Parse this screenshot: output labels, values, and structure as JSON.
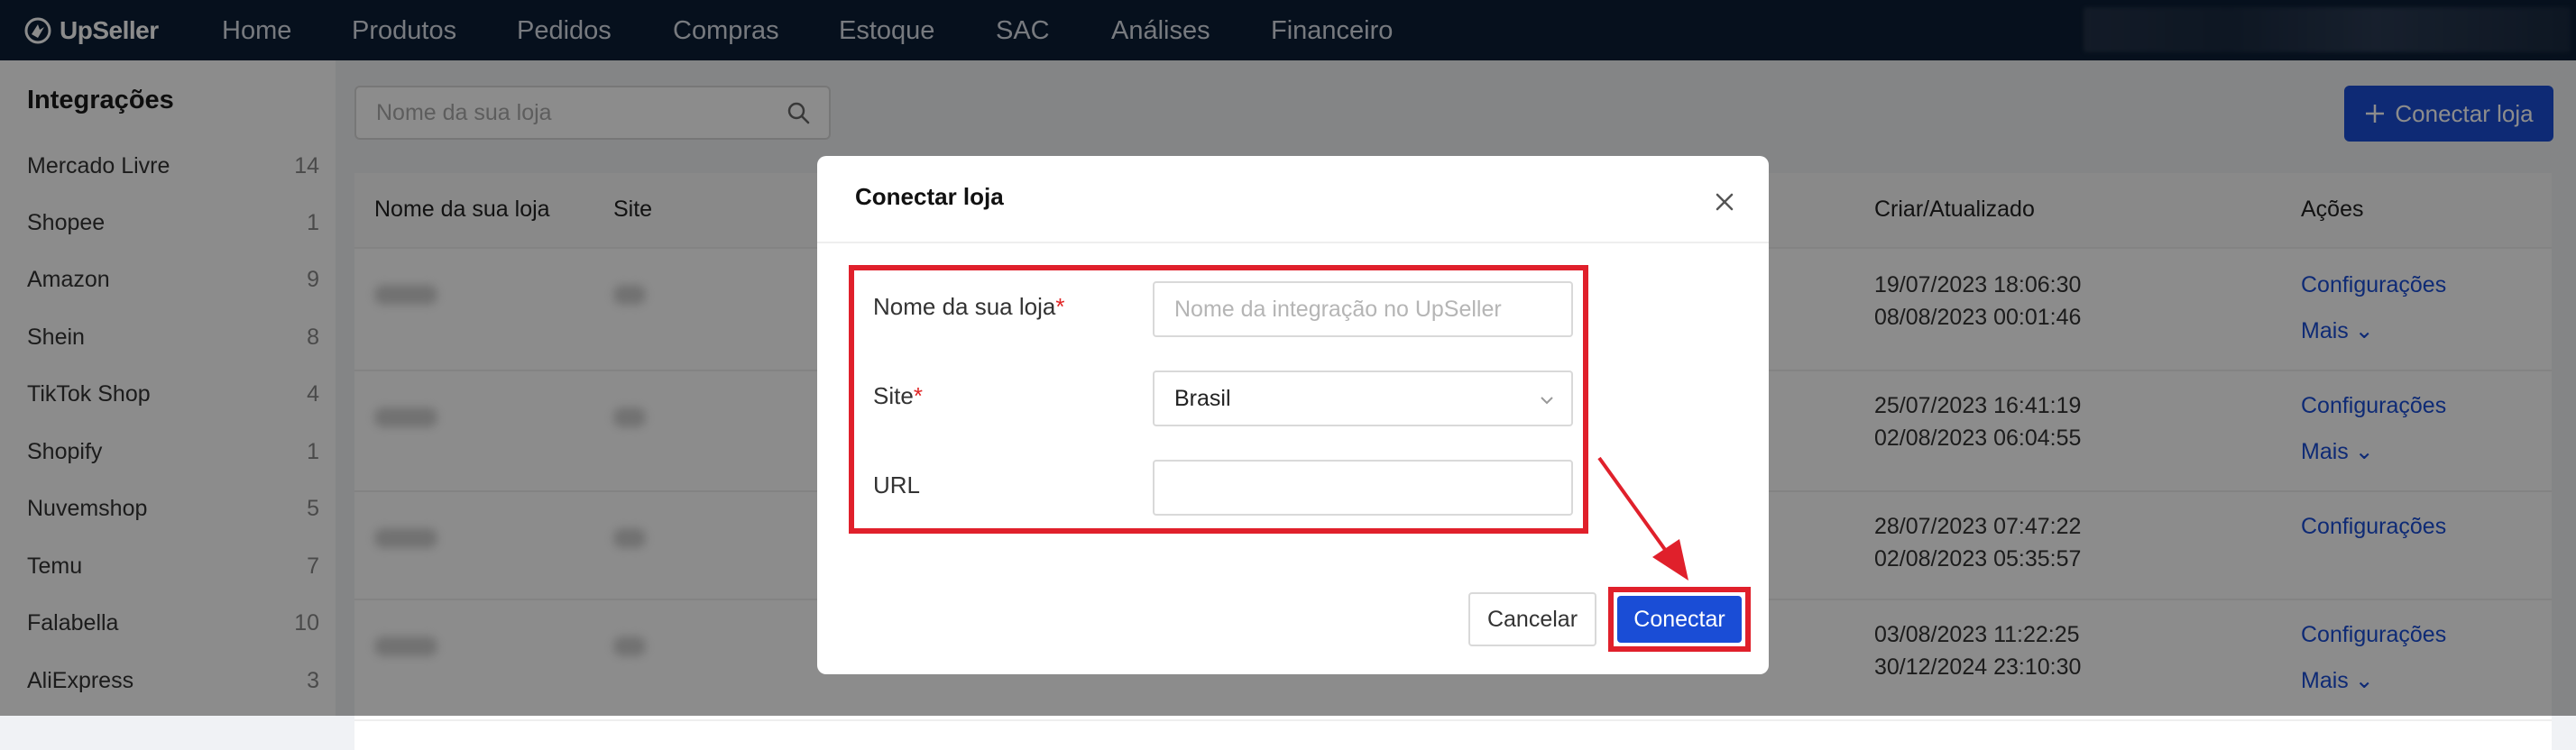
{
  "app": {
    "logo_text": "UpSeller"
  },
  "nav": {
    "items": [
      "Home",
      "Produtos",
      "Pedidos",
      "Compras",
      "Estoque",
      "SAC",
      "Análises",
      "Financeiro"
    ]
  },
  "sidebar": {
    "title": "Integrações",
    "items": [
      {
        "label": "Mercado Livre",
        "count": "14"
      },
      {
        "label": "Shopee",
        "count": "1"
      },
      {
        "label": "Amazon",
        "count": "9"
      },
      {
        "label": "Shein",
        "count": "8"
      },
      {
        "label": "TikTok Shop",
        "count": "4"
      },
      {
        "label": "Shopify",
        "count": "1"
      },
      {
        "label": "Nuvemshop",
        "count": "5"
      },
      {
        "label": "Temu",
        "count": "7"
      },
      {
        "label": "Falabella",
        "count": "10"
      },
      {
        "label": "AliExpress",
        "count": "3"
      }
    ]
  },
  "toolbar": {
    "search_placeholder": "Nome da sua loja",
    "connect_label": "Conectar loja"
  },
  "table": {
    "headers": {
      "name": "Nome da sua loja",
      "site": "Site",
      "created": "Criar/Atualizado",
      "actions": "Ações"
    },
    "rows": [
      {
        "created": "19/07/2023 18:06:30",
        "updated": "08/08/2023 00:01:46",
        "config": "Configurações",
        "more": "Mais"
      },
      {
        "created": "25/07/2023 16:41:19",
        "updated": "02/08/2023 06:04:55",
        "config": "Configurações",
        "more": "Mais"
      },
      {
        "created": "28/07/2023 07:47:22",
        "updated": "02/08/2023 05:35:57",
        "config": "Configurações",
        "more": ""
      },
      {
        "created": "03/08/2023 11:22:25",
        "updated": "30/12/2024 23:10:30",
        "config": "Configurações",
        "more": "Mais"
      }
    ]
  },
  "modal": {
    "title": "Conectar loja",
    "fields": {
      "name_label": "Nome da sua loja",
      "name_placeholder": "Nome da integração no UpSeller",
      "site_label": "Site",
      "site_value": "Brasil",
      "url_label": "URL",
      "url_value": ""
    },
    "required_mark": "*",
    "cancel_label": "Cancelar",
    "submit_label": "Conectar"
  },
  "colors": {
    "primary": "#1a4dd6",
    "nav_bg": "#0c1e35",
    "highlight": "#e0202b"
  }
}
